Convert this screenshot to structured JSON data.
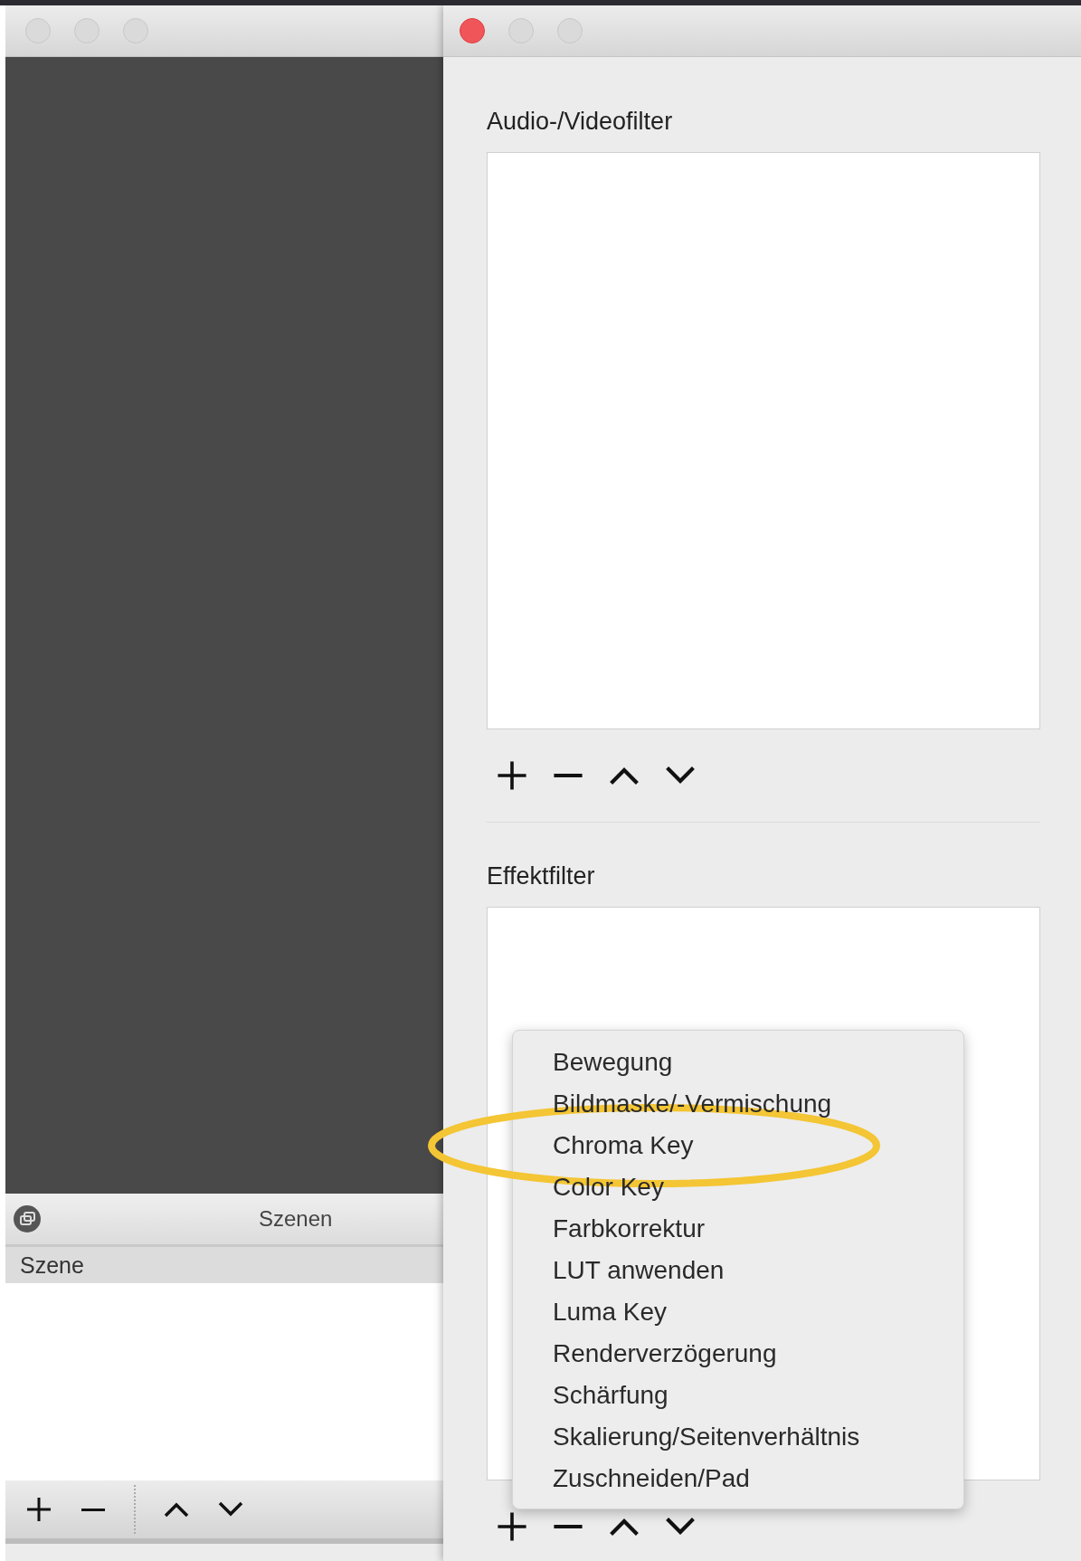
{
  "scenes_window": {
    "dock_title": "Szenen",
    "column_header": "Szene"
  },
  "filter_window": {
    "sections": [
      {
        "title": "Audio-/Videofilter"
      },
      {
        "title": "Effektfilter"
      }
    ]
  },
  "add_menu": {
    "items": [
      {
        "label": "Bewegung",
        "circled": false
      },
      {
        "label": "Bildmaske/-Vermischung",
        "circled": false
      },
      {
        "label": "Chroma Key",
        "circled": true
      },
      {
        "label": "Color Key",
        "circled": false
      },
      {
        "label": "Farbkorrektur",
        "circled": false
      },
      {
        "label": "LUT anwenden",
        "circled": false
      },
      {
        "label": "Luma Key",
        "circled": false
      },
      {
        "label": "Renderverzögerung",
        "circled": false
      },
      {
        "label": "Schärfung",
        "circled": false
      },
      {
        "label": "Skalierung/Seitenverhältnis",
        "circled": false
      },
      {
        "label": "Zuschneiden/Pad",
        "circled": false
      }
    ]
  }
}
